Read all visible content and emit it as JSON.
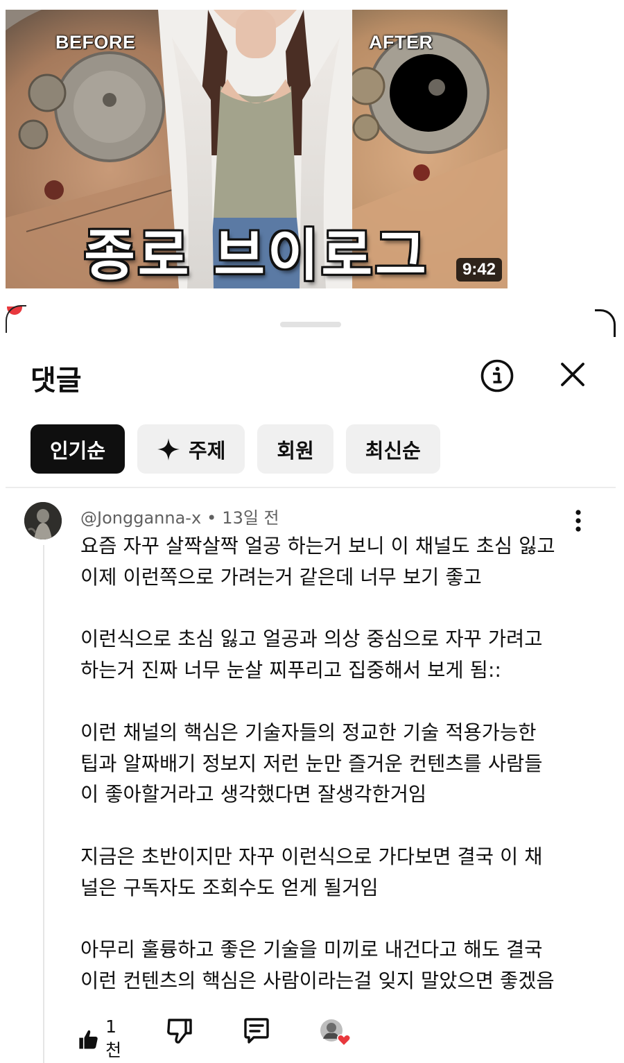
{
  "video": {
    "label_before": "BEFORE",
    "label_after": "AFTER",
    "title_overlay": "종로 브이로그",
    "duration": "9:42"
  },
  "panel": {
    "title": "댓글",
    "info_icon": "info-circle-icon",
    "close_icon": "close-icon"
  },
  "filters": [
    {
      "label": "인기순",
      "active": true
    },
    {
      "label": "주제",
      "active": false,
      "icon": "sparkle-icon"
    },
    {
      "label": "회원",
      "active": false
    },
    {
      "label": "최신순",
      "active": false
    }
  ],
  "comment": {
    "author": "@Jongganna-x",
    "time": "13일 전",
    "paragraphs": [
      [
        "요즘 자꾸 살짝살짝 얼공 하는거 보니 이 채널도 초심 잃고",
        "이제 이런쪽으로 가려는거 같은데 너무 보기 좋고"
      ],
      [
        "이런식으로 초심 잃고 얼공과 의상 중심으로 자꾸 가려고",
        "하는거 진짜 너무 눈살 찌푸리고 집중해서 보게 됨::"
      ],
      [
        "이런 채널의 핵심은 기술자들의 정교한 기술 적용가능한",
        "팁과 알짜배기 정보지 저런 눈만 즐거운 컨텐츠를 사람들",
        "이 좋아할거라고 생각했다면 잘생각한거임"
      ],
      [
        "지금은 초반이지만 자꾸 이런식으로 가다보면 결국 이 채",
        "널은 구독자도 조회수도 얻게 될거임"
      ],
      [
        "아무리 훌륭하고 좋은 기술을 미끼로 내건다고 해도 결국",
        "이런 컨텐츠의 핵심은 사람이라는걸 잊지 말았으면 좋겠음"
      ]
    ],
    "likes": "1천"
  }
}
